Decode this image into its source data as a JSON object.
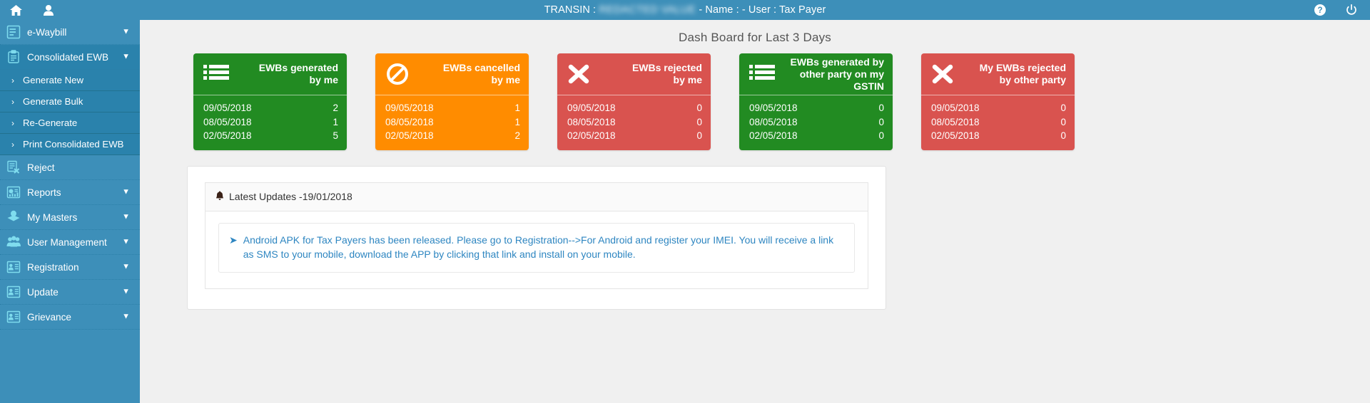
{
  "header": {
    "title_prefix": "TRANSIN :",
    "transin_value": "REDACTED VALUE",
    "title_suffix": "- Name : - User : Tax Payer",
    "home_icon": "home-icon",
    "user_icon": "user-icon",
    "help_icon": "help-icon",
    "power_icon": "power-icon"
  },
  "sidebar": {
    "items": [
      {
        "label": "e-Waybill",
        "icon": "document-lines-icon",
        "level": 0,
        "chevron": "⌄",
        "shade": "light"
      },
      {
        "label": "Consolidated EWB",
        "icon": "clipboard-icon",
        "level": 0,
        "chevron": "⌄",
        "shade": "dark"
      },
      {
        "label": "Generate New",
        "icon": "chevron-right-icon",
        "level": 1,
        "chevron": "",
        "shade": "dark"
      },
      {
        "label": "Generate Bulk",
        "icon": "chevron-right-icon",
        "level": 1,
        "chevron": "",
        "shade": "dark"
      },
      {
        "label": "Re-Generate",
        "icon": "chevron-right-icon",
        "level": 1,
        "chevron": "",
        "shade": "dark"
      },
      {
        "label": "Print Consolidated EWB",
        "icon": "chevron-right-icon",
        "level": 1,
        "chevron": "",
        "shade": "dark"
      },
      {
        "label": "Reject",
        "icon": "document-x-icon",
        "level": 0,
        "chevron": "",
        "shade": "light"
      },
      {
        "label": "Reports",
        "icon": "report-chart-icon",
        "level": 0,
        "chevron": "⌄",
        "shade": "light"
      },
      {
        "label": "My Masters",
        "icon": "masters-icon",
        "level": 0,
        "chevron": "⌄",
        "shade": "light"
      },
      {
        "label": "User Management",
        "icon": "users-group-icon",
        "level": 0,
        "chevron": "⌄",
        "shade": "light"
      },
      {
        "label": "Registration",
        "icon": "id-card-icon",
        "level": 0,
        "chevron": "⌄",
        "shade": "light"
      },
      {
        "label": "Update",
        "icon": "id-card-icon",
        "level": 0,
        "chevron": "⌄",
        "shade": "light"
      },
      {
        "label": "Grievance",
        "icon": "id-card-icon",
        "level": 0,
        "chevron": "⌄",
        "shade": "light"
      }
    ]
  },
  "main": {
    "dash_title": "Dash Board for Last 3 Days",
    "cards": [
      {
        "title_line1": "EWBs generated",
        "title_line2": "by me",
        "color": "green",
        "color_hex": "#228b22",
        "icon": "list-icon",
        "rows": [
          {
            "date": "09/05/2018",
            "value": "2"
          },
          {
            "date": "08/05/2018",
            "value": "1"
          },
          {
            "date": "02/05/2018",
            "value": "5"
          }
        ]
      },
      {
        "title_line1": "EWBs cancelled",
        "title_line2": "by me",
        "color": "orange",
        "color_hex": "#ff8c00",
        "icon": "ban-icon",
        "rows": [
          {
            "date": "09/05/2018",
            "value": "1"
          },
          {
            "date": "08/05/2018",
            "value": "1"
          },
          {
            "date": "02/05/2018",
            "value": "2"
          }
        ]
      },
      {
        "title_line1": "EWBs rejected",
        "title_line2": "by me",
        "color": "red",
        "color_hex": "#d9534f",
        "icon": "times-icon",
        "rows": [
          {
            "date": "09/05/2018",
            "value": "0"
          },
          {
            "date": "08/05/2018",
            "value": "0"
          },
          {
            "date": "02/05/2018",
            "value": "0"
          }
        ]
      },
      {
        "title_line1": "EWBs generated by",
        "title_line2": "other party on my GSTIN",
        "color": "green",
        "color_hex": "#228b22",
        "icon": "list-icon",
        "rows": [
          {
            "date": "09/05/2018",
            "value": "0"
          },
          {
            "date": "08/05/2018",
            "value": "0"
          },
          {
            "date": "02/05/2018",
            "value": "0"
          }
        ]
      },
      {
        "title_line1": "My EWBs rejected",
        "title_line2": "by other party",
        "color": "red",
        "color_hex": "#d9534f",
        "icon": "times-icon",
        "rows": [
          {
            "date": "09/05/2018",
            "value": "0"
          },
          {
            "date": "08/05/2018",
            "value": "0"
          },
          {
            "date": "02/05/2018",
            "value": "0"
          }
        ]
      }
    ],
    "updates": {
      "heading": "Latest Updates -19/01/2018",
      "bell_icon": "bell-icon",
      "arrow_icon": "arrow-right-icon",
      "notice": "Android APK for Tax Payers has been released. Please go to Registration-->For Android and register your IMEI. You will receive a link as SMS to your mobile, download the APP by clicking that link and install on your mobile."
    }
  }
}
